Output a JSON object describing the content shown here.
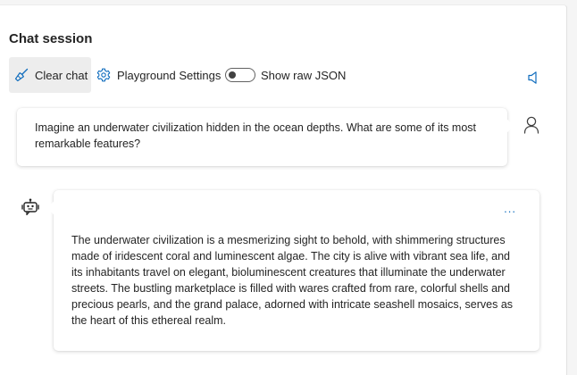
{
  "header": {
    "title": "Chat session"
  },
  "toolbar": {
    "clear_label": "Clear chat",
    "settings_label": "Playground Settings",
    "raw_json_label": "Show raw JSON",
    "raw_json_enabled": false
  },
  "messages": [
    {
      "role": "user",
      "text": "Imagine an underwater civilization hidden in the ocean depths. What are some of its most remarkable features?"
    },
    {
      "role": "assistant",
      "more_label": "...",
      "text": "The underwater civilization is a mesmerizing sight to behold, with shimmering structures made of iridescent coral and luminescent algae. The city is alive with vibrant sea life, and its inhabitants travel on elegant, bioluminescent creatures that illuminate the underwater streets. The bustling marketplace is filled with wares crafted from rare, colorful shells and precious pearls, and the grand palace, adorned with intricate seashell mosaics, serves as the heart of this ethereal realm."
    }
  ],
  "icons": {
    "clear": "broom-icon",
    "settings": "gear-icon",
    "speaker": "speaker-icon",
    "user": "person-icon",
    "bot": "bot-icon"
  },
  "colors": {
    "accent": "#0f6cbd",
    "clear_button_bg": "#ededed",
    "page_bg": "#f5f5f5",
    "panel_bg": "#ffffff"
  }
}
